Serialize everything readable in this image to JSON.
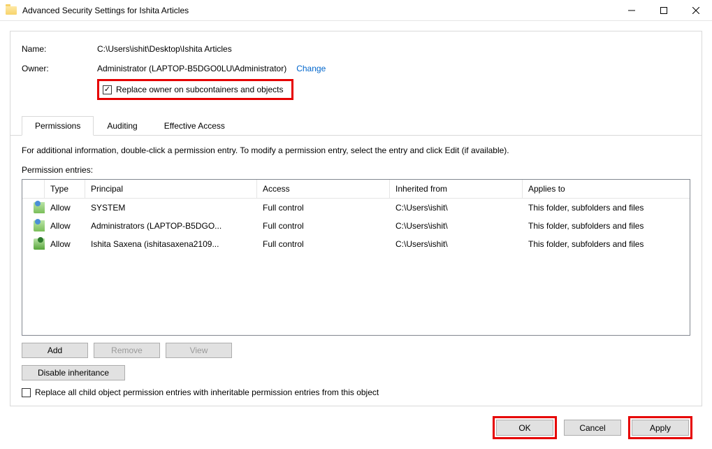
{
  "titlebar": {
    "title": "Advanced Security Settings for Ishita Articles"
  },
  "info": {
    "name_label": "Name:",
    "name_value": "C:\\Users\\ishit\\Desktop\\Ishita Articles",
    "owner_label": "Owner:",
    "owner_value": "Administrator (LAPTOP-B5DGO0LU\\Administrator)",
    "change_label": "Change",
    "replace_owner_label": "Replace owner on subcontainers and objects"
  },
  "tabs": [
    {
      "label": "Permissions",
      "active": true
    },
    {
      "label": "Auditing",
      "active": false
    },
    {
      "label": "Effective Access",
      "active": false
    }
  ],
  "tab_body": {
    "info_text": "For additional information, double-click a permission entry. To modify a permission entry, select the entry and click Edit (if available).",
    "entries_label": "Permission entries:",
    "headers": {
      "type": "Type",
      "principal": "Principal",
      "access": "Access",
      "inherited": "Inherited from",
      "applies": "Applies to"
    },
    "rows": [
      {
        "icon": "group",
        "type": "Allow",
        "principal": "SYSTEM",
        "access": "Full control",
        "inherited": "C:\\Users\\ishit\\",
        "applies": "This folder, subfolders and files"
      },
      {
        "icon": "group",
        "type": "Allow",
        "principal": "Administrators (LAPTOP-B5DGO...",
        "access": "Full control",
        "inherited": "C:\\Users\\ishit\\",
        "applies": "This folder, subfolders and files"
      },
      {
        "icon": "user",
        "type": "Allow",
        "principal": "Ishita Saxena (ishitasaxena2109...",
        "access": "Full control",
        "inherited": "C:\\Users\\ishit\\",
        "applies": "This folder, subfolders and files"
      }
    ],
    "buttons": {
      "add": "Add",
      "remove": "Remove",
      "view": "View",
      "disable_inheritance": "Disable inheritance"
    },
    "replace_child_label": "Replace all child object permission entries with inheritable permission entries from this object"
  },
  "footer": {
    "ok": "OK",
    "cancel": "Cancel",
    "apply": "Apply"
  }
}
